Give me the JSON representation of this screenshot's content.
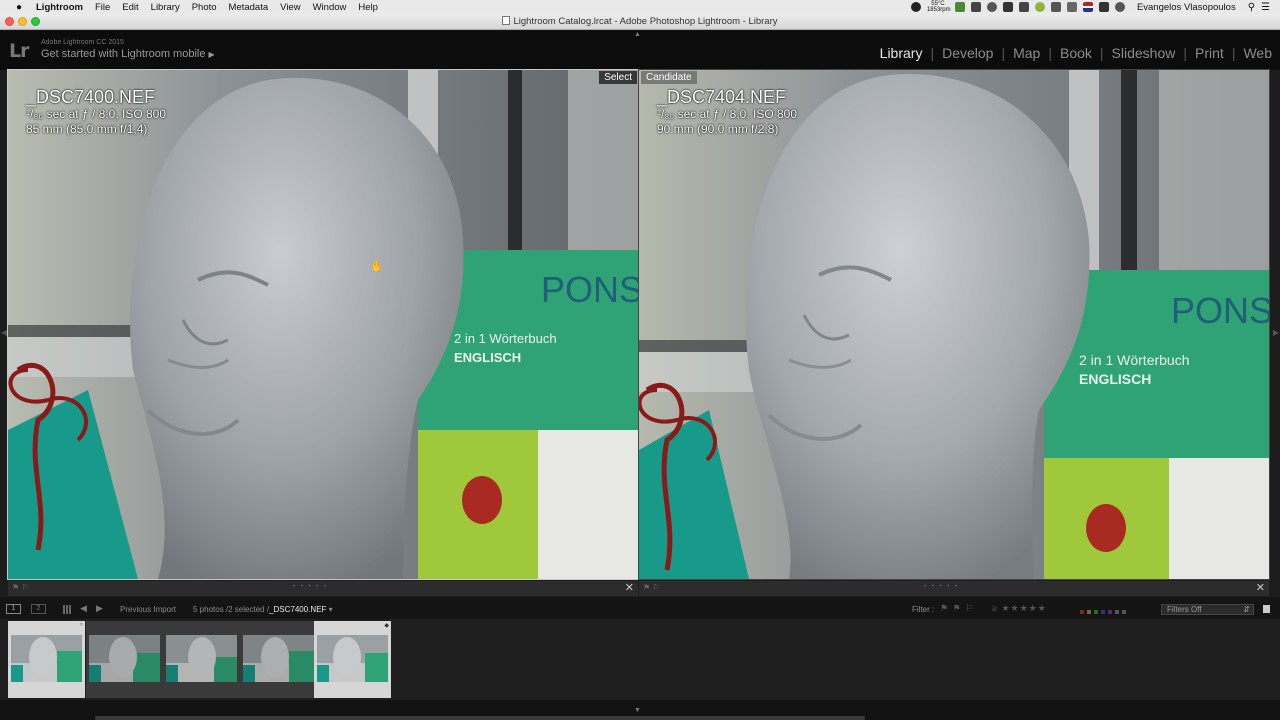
{
  "menubar": {
    "apple": "",
    "app": "Lightroom",
    "items": [
      "File",
      "Edit",
      "Library",
      "Photo",
      "Metadata",
      "View",
      "Window",
      "Help"
    ],
    "temp": "55°C",
    "rpm": "1853rpm",
    "user": "Evangelos Vlasopoulos"
  },
  "window": {
    "title": "Lightroom Catalog.lrcat - Adobe Photoshop Lightroom - Library"
  },
  "identity": {
    "logo": "Lr",
    "version": "Adobe Lightroom CC 2015",
    "mobile": "Get started with Lightroom mobile"
  },
  "modules": [
    "Library",
    "Develop",
    "Map",
    "Book",
    "Slideshow",
    "Print",
    "Web"
  ],
  "active_module": "Library",
  "compare": {
    "select": {
      "badge": "Select",
      "filename": "_DSC7400.NEF",
      "exposure": "¹/₈₀ sec at ƒ / 8,0, ISO 800",
      "lens": "85 mm (85,0 mm f/1,4)"
    },
    "candidate": {
      "badge": "Candidate",
      "filename": "_DSC7404.NEF",
      "exposure": "¹/₈₀ sec at ƒ / 8,0, ISO 800",
      "lens": "90 mm (90,0 mm f/2,8)"
    },
    "book_word": "PONS",
    "book_line1": "2 in 1 Wörterbuch",
    "book_line2": "ENGLISCH"
  },
  "filmstrip_bar": {
    "monitor1": "1",
    "monitor2": "2",
    "source": "Previous Import",
    "count": "5 photos /2 selected /",
    "current": "_DSC7400.NEF",
    "filter_label": "Filter :",
    "filters_value": "Filters Off"
  },
  "colors": {
    "accent": "#e6e6e6",
    "background": "#151515",
    "book_green": "#2fb07a",
    "lime": "#9fd234"
  }
}
